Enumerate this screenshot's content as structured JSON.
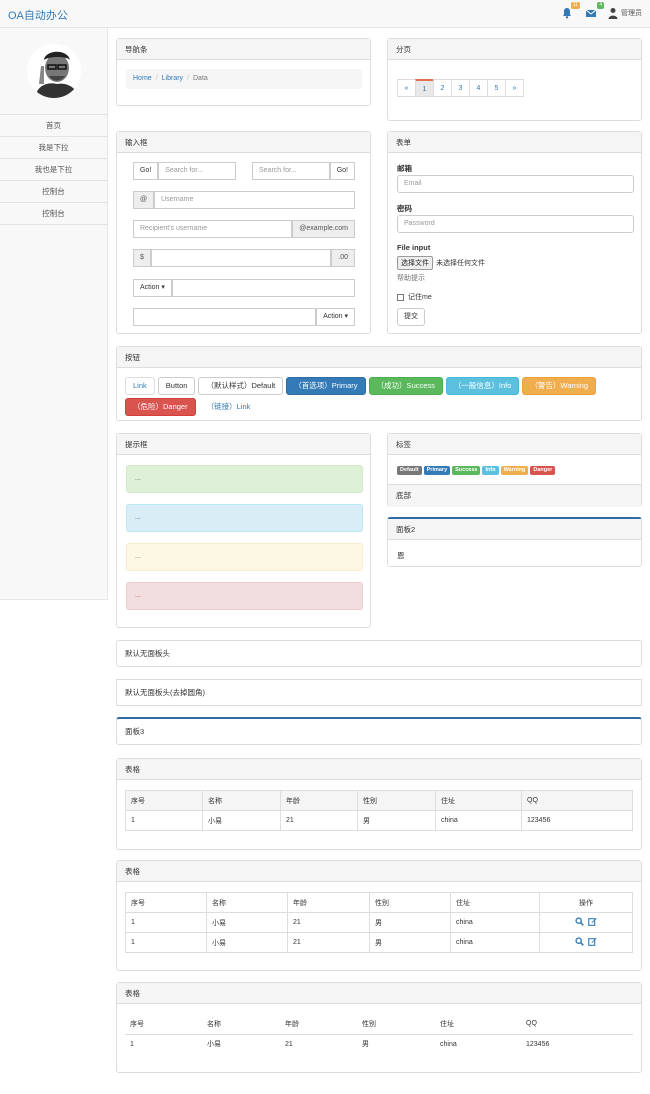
{
  "topbar": {
    "brand": "OA自动办公",
    "bell_badge": "11",
    "mail_badge": "4",
    "user": "管理员",
    "colors": {
      "bell_badge": "#f0ad4e",
      "mail_badge": "#5cb85c",
      "accent": "#337ab7"
    }
  },
  "sidebar": {
    "items": [
      "首页",
      "我是下拉",
      "我也是下拉",
      "控制台",
      "控制台"
    ]
  },
  "nav_panel": {
    "title": "导航条",
    "breadcrumb": [
      "Home",
      "Library",
      "Data"
    ]
  },
  "page_panel": {
    "title": "分页",
    "prev": "«",
    "pages": [
      "1",
      "2",
      "3",
      "4",
      "5"
    ],
    "next": "»",
    "active": "1"
  },
  "input_panel": {
    "title": "输入框",
    "go_label": "Go!",
    "search_placeholder": "Search for...",
    "at": "@",
    "username_placeholder": "Username",
    "recipient_placeholder": "Recipient's username",
    "example_com": "@example.com",
    "dollar": "$",
    "cents": ".00",
    "action_label": "Action ▾"
  },
  "form_panel": {
    "title": "表单",
    "email_label": "邮箱",
    "email_placeholder": "Email",
    "password_label": "密码",
    "password_placeholder": "Password",
    "file_label": "File input",
    "file_button": "选择文件",
    "file_status": "未选择任何文件",
    "help_text": "帮助提示",
    "remember": "记住me",
    "submit": "提交"
  },
  "buttons_panel": {
    "title": "按钮",
    "buttons": {
      "link": "Link",
      "button": "Button",
      "default": "（默认样式）Default",
      "primary": "（首选项）Primary",
      "success": "（成功）Success",
      "info": "（一般信息）Info",
      "warning": "（警告）Warning",
      "danger": "（危险）Danger",
      "link2": "（链接）Link"
    }
  },
  "alerts_panel": {
    "title": "提示框",
    "alerts": [
      "...",
      "...",
      "...",
      "..."
    ]
  },
  "labels_panel": {
    "title": "标签",
    "labels": [
      "Default",
      "Primary",
      "Success",
      "Info",
      "Warning",
      "Danger"
    ],
    "footer": "底部"
  },
  "panel2": {
    "title": "面板2",
    "body": "恩"
  },
  "plain_panels": {
    "no_header": "默认无面板头",
    "no_header_rounded": "默认无面板头(去掉圆角)",
    "panel3": "面板3"
  },
  "table1": {
    "title": "表格",
    "headers": [
      "序号",
      "名称",
      "年龄",
      "性别",
      "住址",
      "QQ"
    ],
    "rows": [
      [
        "1",
        "小易",
        "21",
        "男",
        "china",
        "123456"
      ]
    ]
  },
  "table2": {
    "title": "表格",
    "headers": [
      "序号",
      "名称",
      "年龄",
      "性别",
      "住址",
      "操作"
    ],
    "rows": [
      [
        "1",
        "小易",
        "21",
        "男",
        "china"
      ],
      [
        "1",
        "小易",
        "21",
        "男",
        "china"
      ]
    ]
  },
  "table3": {
    "title": "表格",
    "headers": [
      "序号",
      "名称",
      "年龄",
      "性别",
      "住址",
      "QQ"
    ],
    "rows": [
      [
        "1",
        "小易",
        "21",
        "男",
        "china",
        "123456"
      ]
    ]
  }
}
